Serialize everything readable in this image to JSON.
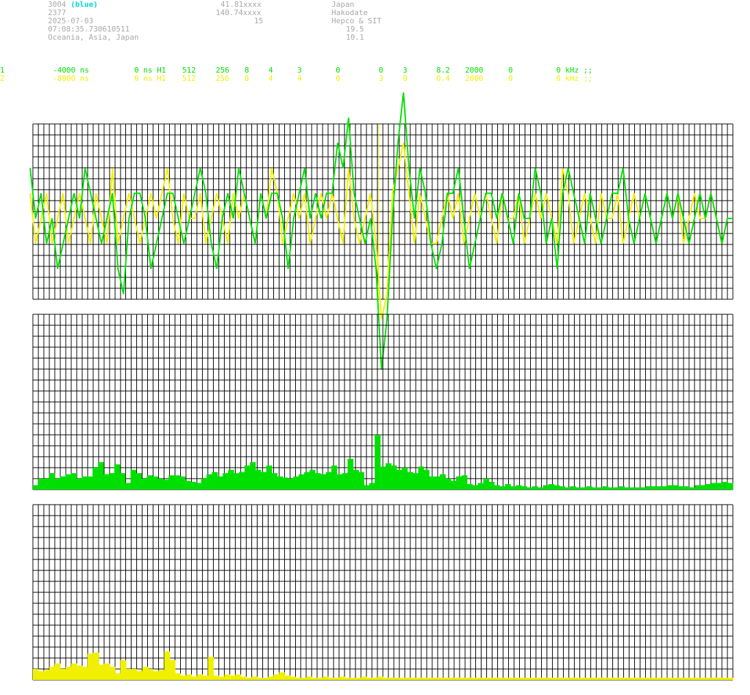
{
  "header": {
    "col1": [
      "3004",
      "2377",
      "2025-07-03",
      "07:08:35.730610511",
      "Oceania, Asia, Japan"
    ],
    "col1_suffix": "(blue)",
    "col2": [
      "41.81xxxx",
      "140.74xxxx",
      "15"
    ],
    "col3": [
      "Japan",
      "Hakodate",
      "Hepco & SIT"
    ],
    "col4": [
      "19.5",
      "10.1"
    ]
  },
  "channels": [
    {
      "id": "1",
      "color": "#00e000",
      "fields": [
        "-4000 ns",
        "0 ns H1",
        "512",
        "256",
        "8",
        "4",
        "3",
        "0",
        "0",
        "3",
        "8.2",
        "2000",
        "0",
        "0 kHz ;;"
      ]
    },
    {
      "id": "2",
      "color": "#f0f000",
      "fields": [
        "-8000 ns",
        "0 ns H1",
        "512",
        "256",
        "8",
        "4",
        "4",
        "0",
        "3",
        "0",
        "0.4",
        "2000",
        "0",
        "0 kHz ;;"
      ]
    }
  ],
  "colors": {
    "grid": "#000000",
    "channel1": "#00e000",
    "channel2": "#f0f000",
    "marker": "#f0f000",
    "header_text": "#a8a8a8",
    "highlight": "#00d8d8"
  },
  "chart_data": [
    {
      "type": "line",
      "panel": "waveform",
      "x_range": [
        0,
        128
      ],
      "y_range": [
        -8,
        8
      ],
      "grid": true,
      "marker_x": 63,
      "series": [
        {
          "color": "#00e000",
          "values": [
            2,
            0,
            1,
            -1,
            0,
            -2,
            -1,
            0,
            1,
            0,
            2,
            1,
            0,
            -1,
            0,
            1,
            -2,
            -3,
            0,
            1,
            1,
            0,
            -2,
            -1,
            0,
            1,
            1,
            0,
            -1,
            0,
            1,
            2,
            1,
            -1,
            -2,
            0,
            1,
            0,
            2,
            1,
            0,
            -1,
            1,
            0,
            1,
            1,
            0,
            -2,
            0,
            1,
            2,
            0,
            1,
            0,
            1,
            1,
            3,
            2,
            4,
            1,
            0,
            -1,
            0,
            -2,
            -6,
            -4,
            0,
            3,
            5,
            2,
            0,
            2,
            1,
            -1,
            -2,
            -1,
            1,
            1,
            2,
            0,
            -2,
            -1,
            0,
            1,
            1,
            0,
            1,
            0,
            -1,
            1,
            0,
            0,
            2,
            1,
            -1,
            0,
            -2,
            1,
            2,
            1,
            0,
            -1,
            1,
            0,
            -1,
            0,
            1,
            1,
            2,
            0,
            -1,
            0,
            1,
            0,
            -1,
            0,
            1,
            0,
            1,
            0,
            -1,
            0,
            1,
            0,
            1,
            0,
            -1,
            0,
            0
          ]
        },
        {
          "color": "#f0f000",
          "values": [
            1,
            -1,
            0,
            1,
            -1,
            0,
            1,
            -1,
            0,
            1,
            0,
            -1,
            1,
            0,
            -1,
            2,
            -1,
            0,
            1,
            0,
            -1,
            0,
            1,
            0,
            1,
            2,
            0,
            -1,
            1,
            0,
            0,
            1,
            -1,
            0,
            1,
            0,
            -1,
            1,
            0,
            1,
            0,
            -1,
            1,
            0,
            2,
            1,
            -1,
            0,
            1,
            0,
            1,
            -1,
            0,
            1,
            0,
            1,
            0,
            -1,
            2,
            0,
            -1,
            0,
            1,
            -1,
            -4,
            -3,
            1,
            2,
            3,
            1,
            -1,
            1,
            0,
            -1,
            -1,
            0,
            1,
            0,
            1,
            -1,
            0,
            1,
            0,
            1,
            0,
            -1,
            1,
            0,
            0,
            1,
            -1,
            0,
            1,
            0,
            1,
            0,
            -1,
            2,
            1,
            -1,
            0,
            1,
            0,
            -1,
            1,
            0,
            0,
            1,
            -1,
            0,
            1,
            0,
            1,
            0,
            -1,
            0,
            1,
            0,
            1,
            -1,
            0,
            1,
            0,
            0,
            1,
            0,
            -1,
            0,
            0
          ]
        }
      ]
    },
    {
      "type": "bar",
      "panel": "spectrum-1",
      "color": "#00e000",
      "y_range": [
        0,
        16
      ],
      "values": [
        0.4,
        1,
        1,
        1.5,
        1,
        1.2,
        1.4,
        1.5,
        1,
        1.2,
        1.2,
        2,
        2.5,
        1.4,
        1.5,
        2.3,
        1.5,
        0.6,
        1.8,
        1.5,
        1,
        1.3,
        1.2,
        1,
        0.9,
        1.3,
        1.3,
        1.2,
        0.8,
        0.7,
        0.6,
        1,
        1.4,
        1.6,
        1.2,
        1.5,
        1.8,
        1.5,
        1.6,
        2.2,
        2.5,
        1.8,
        1.6,
        2.2,
        1.5,
        1.2,
        1.1,
        1,
        1.2,
        1.4,
        1.6,
        1.8,
        1.5,
        1.4,
        1.6,
        2.2,
        1.4,
        1.5,
        2.8,
        1.8,
        1.6,
        0.4,
        0.6,
        5,
        2.1,
        2.4,
        2.2,
        1.8,
        2,
        1.6,
        1.5,
        2.1,
        1.8,
        1.2,
        1.2,
        1.4,
        1,
        0.8,
        1.2,
        1.3,
        0.5,
        0.4,
        0.6,
        1,
        0.7,
        0.4,
        0.3,
        0.5,
        0.3,
        0.4,
        0.3,
        0.2,
        0.3,
        0.2,
        0.4,
        0.5,
        0.4,
        0.3,
        0.2,
        0.3,
        0.2,
        0.2,
        0.3,
        0.2,
        0.2,
        0.3,
        0.2,
        0.2,
        0.3,
        0.2,
        0.2,
        0.2,
        0.2,
        0.3,
        0.3,
        0.3,
        0.3,
        0.4,
        0.4,
        0.3,
        0.3,
        0.2,
        0.4,
        0.4,
        0.5,
        0.6,
        0.6,
        0.7,
        0.6
      ]
    },
    {
      "type": "bar",
      "panel": "spectrum-2",
      "color": "#f0f000",
      "y_range": [
        0,
        16
      ],
      "values": [
        1,
        0.8,
        0.9,
        1.2,
        1.5,
        1,
        1.2,
        1.5,
        1.3,
        1.2,
        2.4,
        2.5,
        1.4,
        1.5,
        1.2,
        0.6,
        1.8,
        1,
        1,
        0.8,
        1.2,
        1,
        0.8,
        0.9,
        2.6,
        1.8,
        0.6,
        0.4,
        0.5,
        0.3,
        0.5,
        0.4,
        2.1,
        0.4,
        0.3,
        0.5,
        0.4,
        0.5,
        0.3,
        0.2,
        0.3,
        0.2,
        0.2,
        0.3,
        0.5,
        0.7,
        0.4,
        0.3,
        0.2,
        0.2,
        0.3,
        0.2,
        0.2,
        0.3,
        0.2,
        0.2,
        0.3,
        0.2,
        0.2,
        0.2,
        0.3,
        0.2,
        0.2,
        0.3,
        0.2,
        0.2,
        0.2,
        0.2,
        0.2,
        0.2,
        0.2,
        0.2,
        0.2,
        0.2,
        0.2,
        0.2,
        0.2,
        0.2,
        0.2,
        0.2,
        0.2,
        0.2,
        0.2,
        0.2,
        0.2,
        0.2,
        0.2,
        0.2,
        0.2,
        0.2,
        0.2,
        0.2,
        0.2,
        0.2,
        0.2,
        0.2,
        0.2,
        0.2,
        0.2,
        0.2,
        0.2,
        0.2,
        0.2,
        0.2,
        0.2,
        0.2,
        0.2,
        0.2,
        0.2,
        0.2,
        0.2,
        0.2,
        0.2,
        0.2,
        0.2,
        0.2,
        0.2,
        0.2,
        0.2,
        0.2,
        0.2,
        0.2,
        0.2,
        0.2,
        0.2,
        0.2,
        0.2,
        0.2
      ]
    }
  ]
}
